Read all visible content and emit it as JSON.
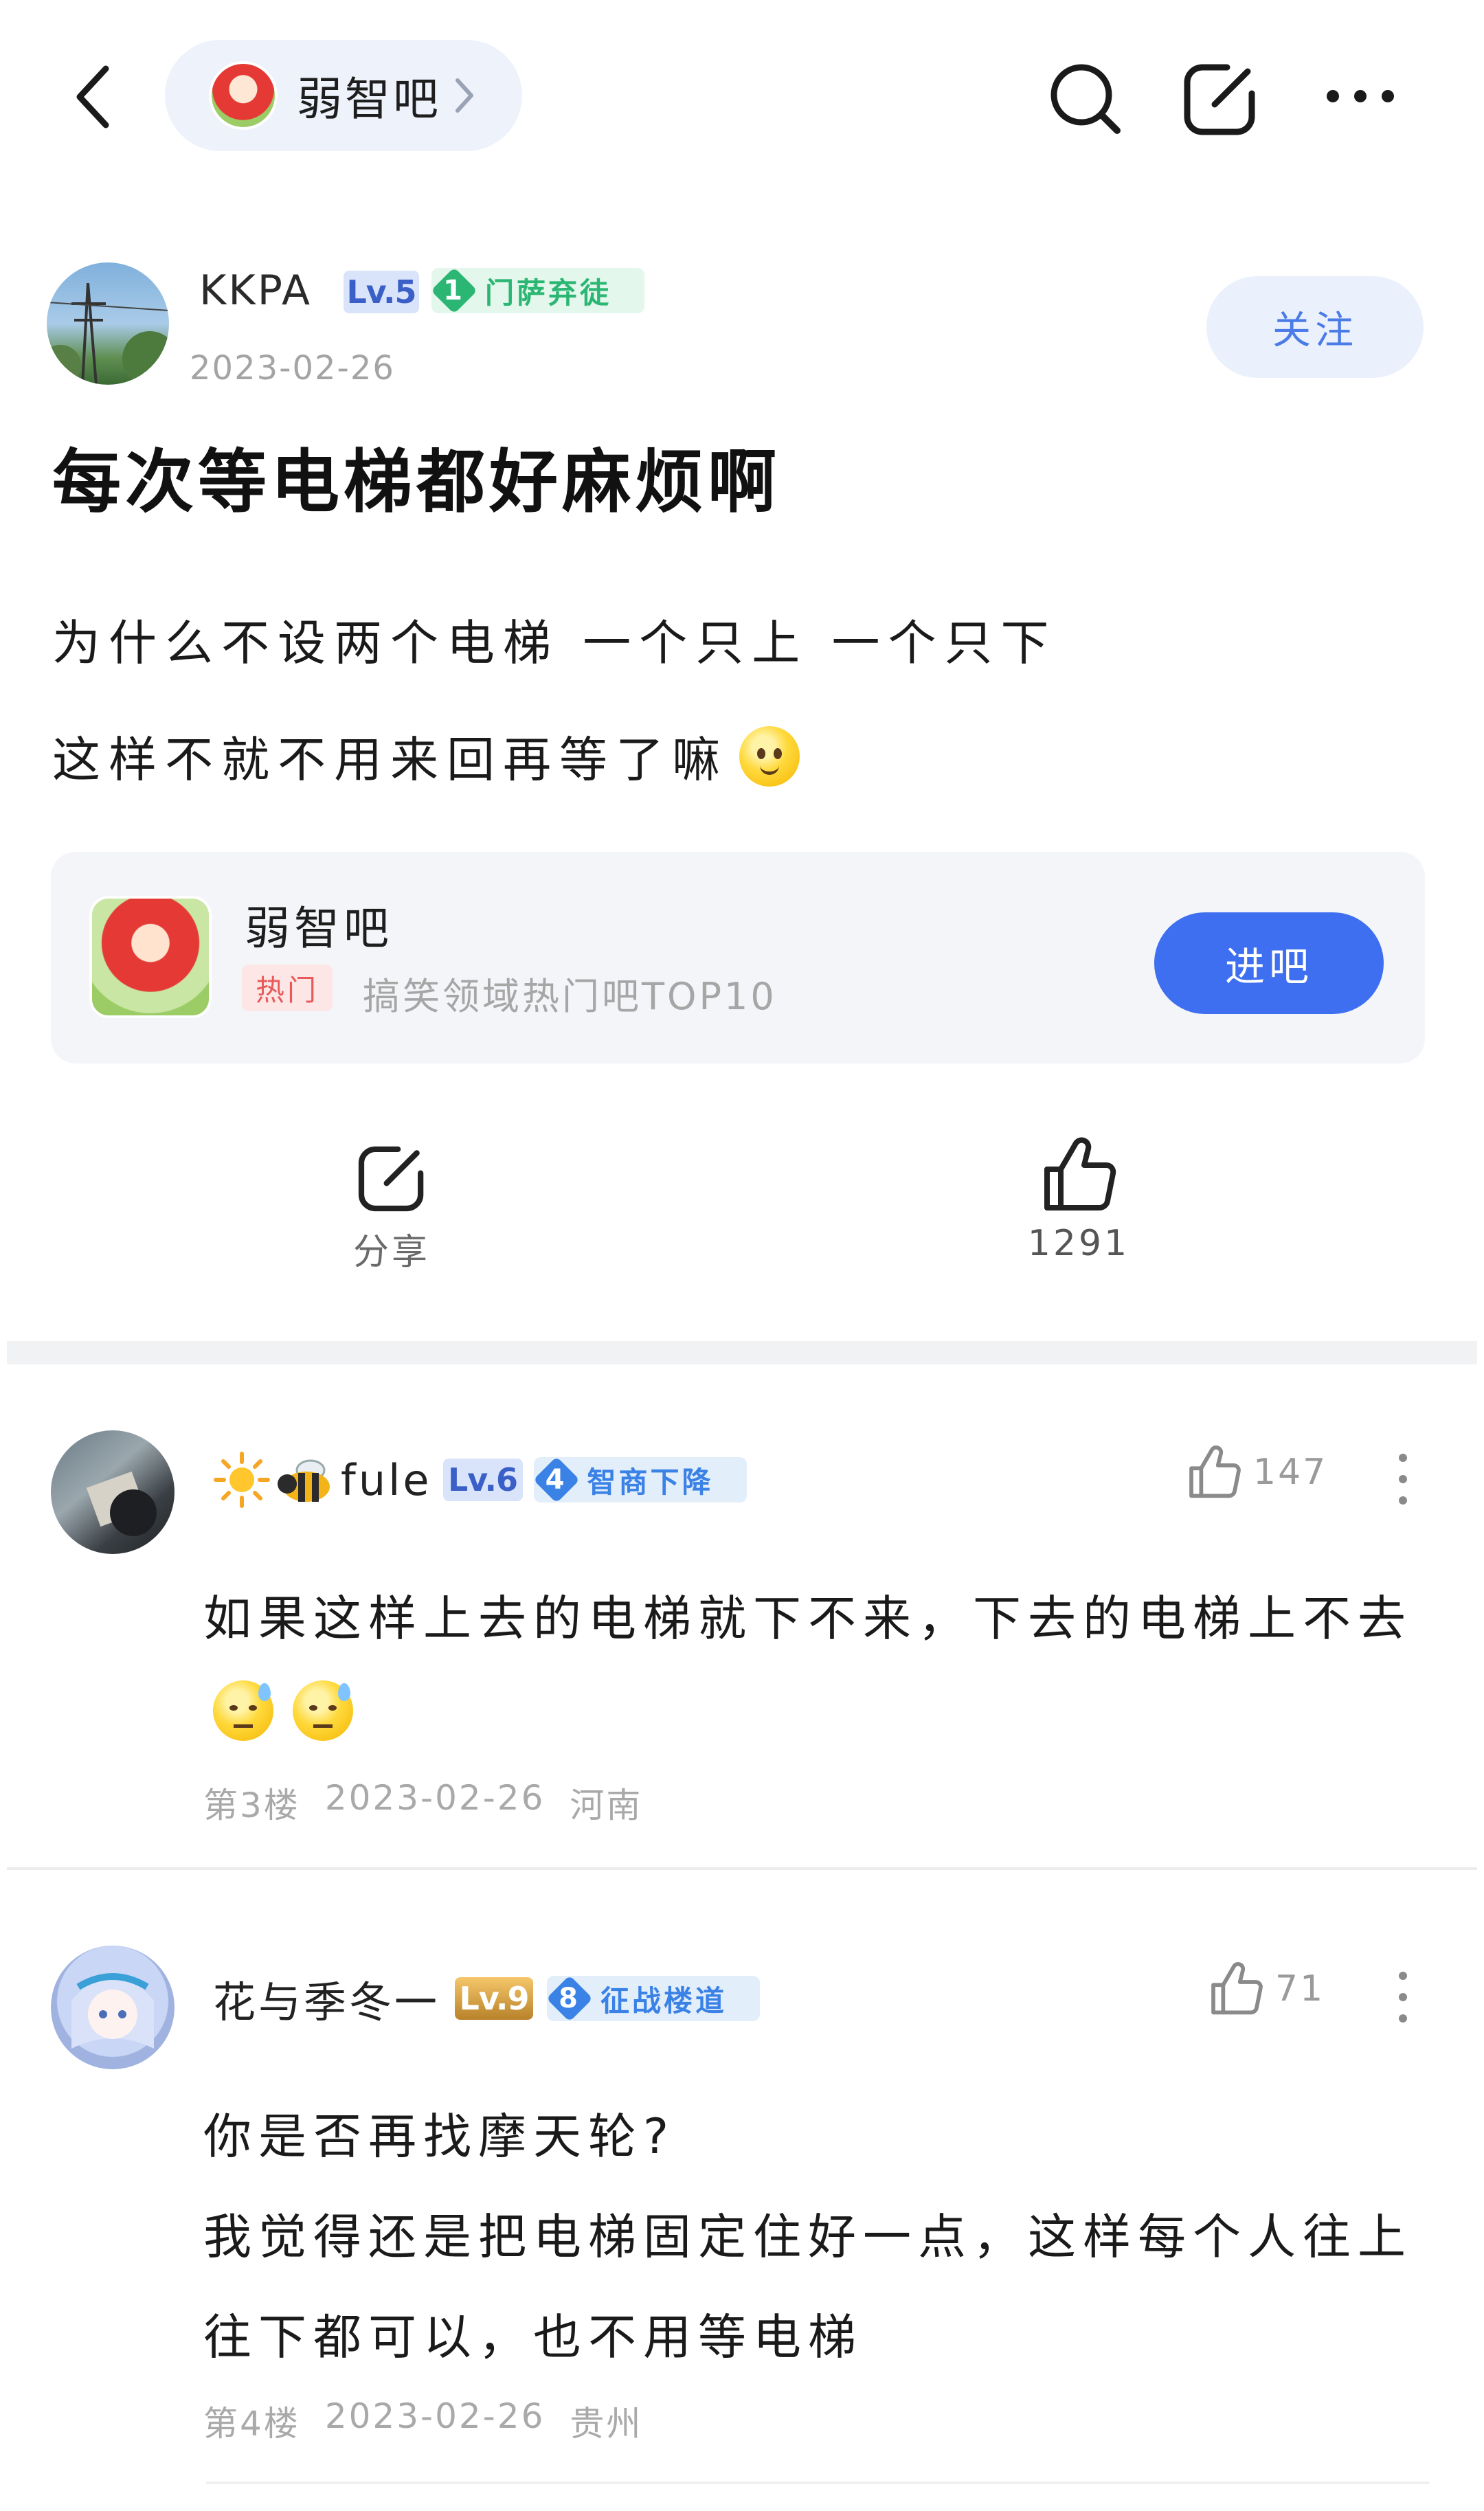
{
  "topbar": {
    "forum_name": "弱智吧",
    "back_icon": "chevron-left-icon",
    "search_icon": "search-icon",
    "compose_icon": "compose-icon",
    "more_icon": "more-horizontal-icon"
  },
  "post": {
    "author": {
      "name": "KKPA",
      "level": "Lv.5",
      "title_level": "1",
      "title": "门萨弃徒",
      "date": "2023-02-26"
    },
    "follow_label": "关注",
    "title": "每次等电梯都好麻烦啊",
    "body": [
      "为什么不设两个电梯 一个只上 一个只下",
      "这样不就不用来回再等了嘛"
    ]
  },
  "forum_card": {
    "name": "弱智吧",
    "tag": "热门",
    "description": "搞笑领域热门吧TOP10",
    "enter_label": "进吧"
  },
  "actions": {
    "share_label": "分享",
    "like_count": "1291"
  },
  "comments": [
    {
      "name": "fule",
      "level": "Lv.6",
      "title_level": "4",
      "title": "智商下降",
      "likes": "147",
      "text": "如果这样上去的电梯就下不来，下去的电梯上不去",
      "floor": "第3楼",
      "date": "2023-02-26",
      "location": "河南"
    },
    {
      "name": "花与季冬一",
      "level": "Lv.9",
      "title_level": "8",
      "title": "征战楼道",
      "likes": "71",
      "lines": [
        "你是否再找摩天轮?",
        "我觉得还是把电梯固定住好一点，这样每个人往上",
        "往下都可以，也不用等电梯"
      ],
      "floor": "第4楼",
      "date": "2023-02-26",
      "location": "贵州"
    }
  ],
  "colors": {
    "accent": "#3d6ff0",
    "follow_text": "#4a7be6",
    "hot_tag": "#e85a5a",
    "badge_green": "#2bb673",
    "badge_blue": "#3b82e6"
  }
}
